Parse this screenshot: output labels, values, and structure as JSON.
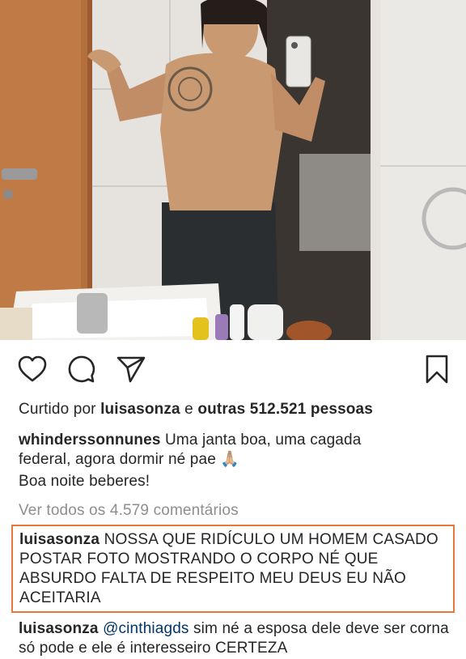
{
  "post": {
    "liked_prefix": "Curtido por",
    "liked_user": "luisasonza",
    "liked_connector": "e",
    "liked_others": "outras 512.521 pessoas",
    "caption_user": "whinderssonnunes",
    "caption_text_1": "Uma janta boa, uma cagada",
    "caption_text_2": "federal, agora dormir né pae",
    "caption_emoji": "🙏🏼",
    "caption_text_3": "Boa noite beberes!",
    "view_all_comments": "Ver todos os 4.579 comentários"
  },
  "comments": [
    {
      "user": "luisasonza",
      "text": "NOSSA QUE RIDÍCULO UM HOMEM CASADO POSTAR FOTO MOSTRANDO O CORPO NÉ QUE ABSURDO FALTA DE RESPEITO MEU DEUS EU NÃO ACEITARIA",
      "highlight_color": "#e8773a"
    },
    {
      "user": "luisasonza",
      "mention": "@cinthiagds",
      "text": "sim né a esposa dele deve ser corna só pode e  ele é interesseiro CERTEZA"
    }
  ],
  "icons": {
    "like": "heart-icon",
    "comment": "comment-bubble-icon",
    "share": "paper-plane-icon",
    "save": "bookmark-icon"
  },
  "colors": {
    "text": "#262626",
    "muted": "#8e8e8e",
    "mention": "#003569"
  }
}
